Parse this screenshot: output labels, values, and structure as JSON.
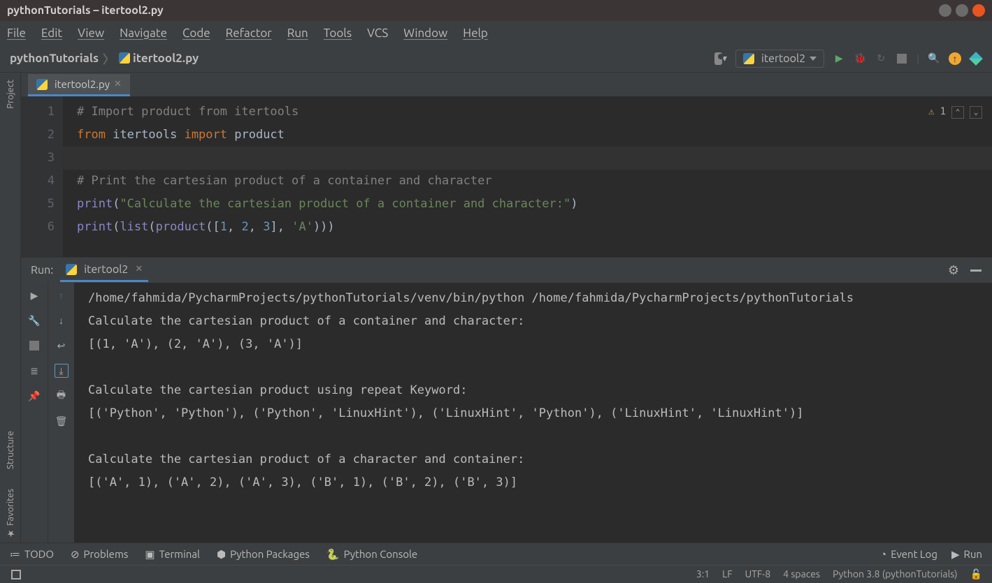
{
  "window": {
    "title": "pythonTutorials – itertool2.py"
  },
  "menu": [
    "File",
    "Edit",
    "View",
    "Navigate",
    "Code",
    "Refactor",
    "Run",
    "Tools",
    "VCS",
    "Window",
    "Help"
  ],
  "breadcrumb": {
    "project": "pythonTutorials",
    "file": "itertool2.py"
  },
  "runconfig": "itertool2",
  "left_rail": {
    "project": "Project",
    "structure": "Structure",
    "favorites": "Favorites"
  },
  "tab": {
    "name": "itertool2.py"
  },
  "editor": {
    "warnings": "1",
    "lines": [
      "1",
      "2",
      "3",
      "4",
      "5",
      "6"
    ],
    "l1_comment": "# Import product from itertools",
    "l2_from": "from",
    "l2_mod": "itertools",
    "l2_import": "import",
    "l2_name": "product",
    "l4_comment": "# Print the cartesian product of a container and character",
    "l5_print": "print",
    "l5_str": "\"Calculate the cartesian product of a container and character:\"",
    "l6_print": "print",
    "l6_list": "list",
    "l6_prod": "product",
    "l6_n1": "1",
    "l6_n2": "2",
    "l6_n3": "3",
    "l6_ch": "'A'"
  },
  "run": {
    "label": "Run:",
    "tab": "itertool2",
    "cmd": "/home/fahmida/PycharmProjects/pythonTutorials/venv/bin/python /home/fahmida/PycharmProjects/pythonTutorials",
    "out1": "Calculate the cartesian product of a container and character:",
    "out2": "[(1, 'A'), (2, 'A'), (3, 'A')]",
    "out3": "",
    "out4": "Calculate the cartesian product using repeat Keyword:",
    "out5": "[('Python', 'Python'), ('Python', 'LinuxHint'), ('LinuxHint', 'Python'), ('LinuxHint', 'LinuxHint')]",
    "out6": "",
    "out7": "Calculate the cartesian product of a character and container:",
    "out8": "[('A', 1), ('A', 2), ('A', 3), ('B', 1), ('B', 2), ('B', 3)]"
  },
  "bottom": {
    "todo": "TODO",
    "problems": "Problems",
    "terminal": "Terminal",
    "pkgs": "Python Packages",
    "pyconsole": "Python Console",
    "eventlog": "Event Log",
    "run": "Run"
  },
  "status": {
    "pos": "3:1",
    "le": "LF",
    "enc": "UTF-8",
    "indent": "4 spaces",
    "interp": "Python 3.8 (pythonTutorials)"
  }
}
